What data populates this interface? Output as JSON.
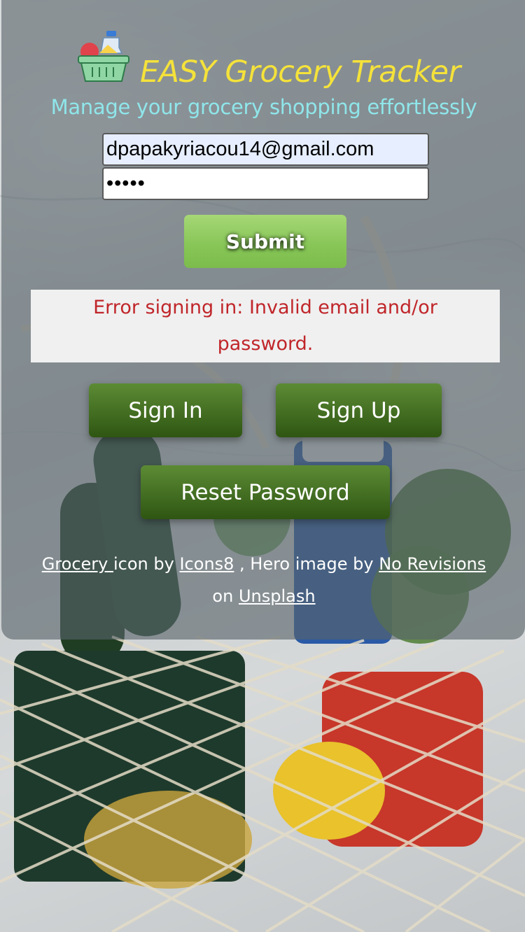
{
  "app": {
    "title": "EASY Grocery Tracker",
    "tagline": "Manage your grocery shopping effortlessly",
    "logo_icon": "grocery-basket-icon"
  },
  "form": {
    "email_value": "dpapakyriacou14@gmail.com",
    "password_value": "12345",
    "submit_label": "Submit"
  },
  "error": {
    "message": "Error signing in: Invalid email and/or password."
  },
  "nav": {
    "sign_in_label": "Sign In",
    "sign_up_label": "Sign Up",
    "reset_password_label": "Reset Password"
  },
  "credits": {
    "grocery_link": "Grocery ",
    "icon_by_text": "icon by ",
    "icons8_link": "Icons8",
    "hero_text": " , Hero image by ",
    "no_revisions_link": "No Revisions",
    "on_text": " on ",
    "unsplash_link": "Unsplash"
  },
  "colors": {
    "title": "#f5e23a",
    "tagline": "#8fe6ea",
    "submit": "#86c556",
    "nav_button": "#436e22",
    "error_text": "#c0262a"
  }
}
